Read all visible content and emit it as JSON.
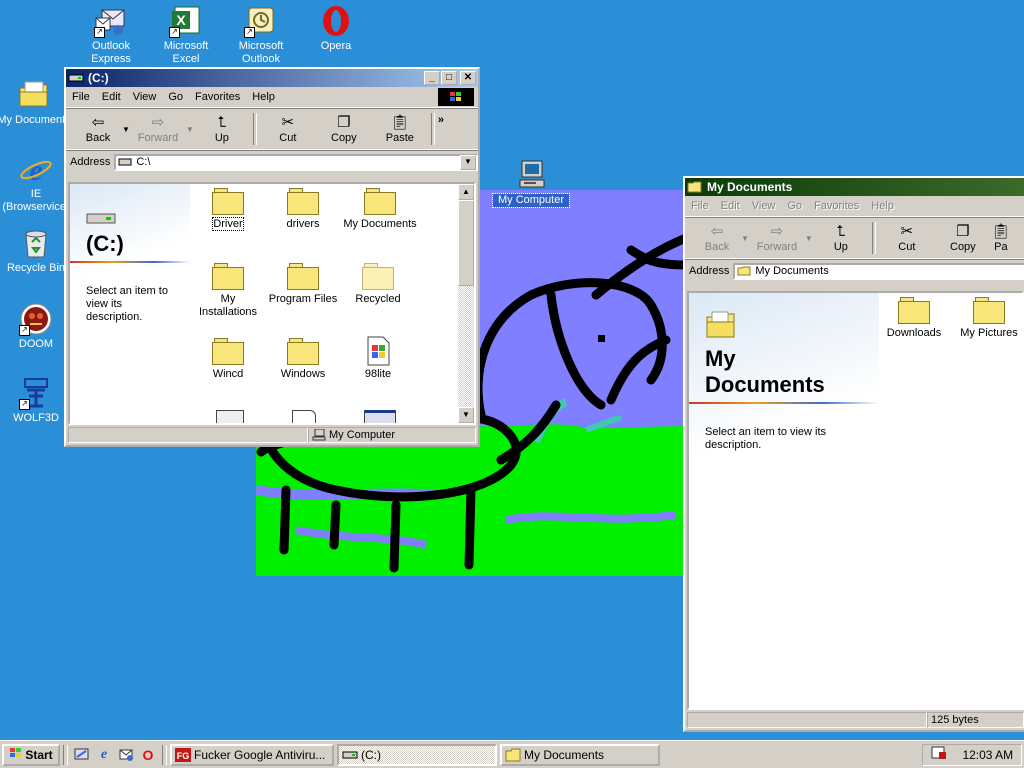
{
  "desktop": {
    "icons": [
      {
        "label": "Outlook Express",
        "name": "outlook-express-icon"
      },
      {
        "label": "Microsoft Excel",
        "name": "excel-icon"
      },
      {
        "label": "Microsoft Outlook",
        "name": "outlook-icon"
      },
      {
        "label": "Opera",
        "name": "opera-icon"
      },
      {
        "label": "My Documents",
        "name": "my-documents-icon"
      },
      {
        "label": "IE (Browservice)",
        "name": "ie-icon"
      },
      {
        "label": "Recycle Bin",
        "name": "recycle-bin-icon"
      },
      {
        "label": "DOOM",
        "name": "doom-icon"
      },
      {
        "label": "WOLF3D",
        "name": "wolf3d-icon"
      },
      {
        "label": "My Computer",
        "name": "my-computer-icon"
      }
    ]
  },
  "window_c": {
    "title": "(C:)",
    "menu": [
      "File",
      "Edit",
      "View",
      "Go",
      "Favorites",
      "Help"
    ],
    "toolbar": {
      "back": "Back",
      "forward": "Forward",
      "up": "Up",
      "cut": "Cut",
      "copy": "Copy",
      "paste": "Paste",
      "more": "»"
    },
    "address_label": "Address",
    "address_value": "C:\\",
    "panel_title": "(C:)",
    "panel_desc": "Select an item to view its description.",
    "items": [
      {
        "label": "Driver",
        "type": "folder"
      },
      {
        "label": "drivers",
        "type": "folder"
      },
      {
        "label": "My Documents",
        "type": "folder"
      },
      {
        "label": "My Installations",
        "type": "folder"
      },
      {
        "label": "Program Files",
        "type": "folder"
      },
      {
        "label": "Recycled",
        "type": "folder-light"
      },
      {
        "label": "Wincd",
        "type": "folder"
      },
      {
        "label": "Windows",
        "type": "folder"
      },
      {
        "label": "98lite",
        "type": "file"
      }
    ],
    "status": "My Computer"
  },
  "window_docs": {
    "title": "My Documents",
    "menu": [
      "File",
      "Edit",
      "View",
      "Go",
      "Favorites",
      "Help"
    ],
    "toolbar": {
      "back": "Back",
      "forward": "Forward",
      "up": "Up",
      "cut": "Cut",
      "copy": "Copy",
      "paste": "Pa"
    },
    "address_label": "Address",
    "address_value": "My Documents",
    "panel_title": "My Documents",
    "panel_desc": "Select an item to view its description.",
    "items": [
      {
        "label": "Downloads",
        "type": "folder"
      },
      {
        "label": "My Pictures",
        "type": "folder"
      }
    ],
    "status": "125 bytes"
  },
  "taskbar": {
    "start_label": "Start",
    "tasks": [
      {
        "label": "Fucker Google Antiviru...",
        "icon": "fg-app-icon",
        "pressed": false
      },
      {
        "label": "(C:)",
        "icon": "drive-icon",
        "pressed": true
      },
      {
        "label": "My Documents",
        "icon": "folder-icon",
        "pressed": false
      }
    ],
    "clock": "12:03 AM"
  }
}
